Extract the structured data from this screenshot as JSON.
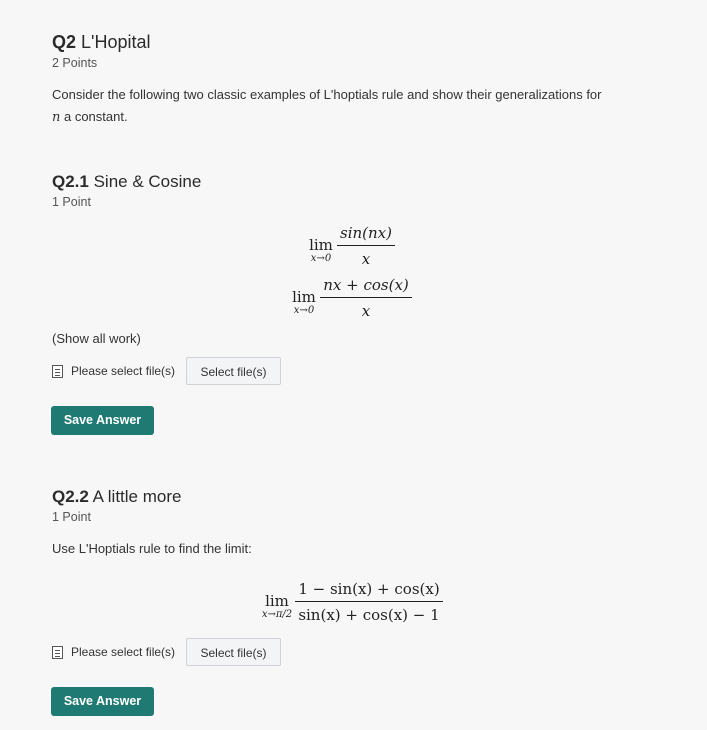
{
  "q2": {
    "number": "Q2",
    "title": "L'Hopital",
    "points": "2 Points",
    "intro": "Consider the following two classic examples of L'hoptials rule and show their generalizations for",
    "intro_var": "n",
    "intro_tail": " a constant."
  },
  "q21": {
    "number": "Q2.1",
    "title": "Sine & Cosine",
    "points": "1 Point",
    "eq1": {
      "lim": "lim",
      "sub": "x→0",
      "num": "sin(nx)",
      "den": "x"
    },
    "eq2": {
      "lim": "lim",
      "sub": "x→0",
      "num": "nx + cos(x)",
      "den": "x"
    },
    "show_work": "(Show all work)",
    "file_label": "Please select file(s)",
    "select_label": "Select file(s)",
    "save_label": "Save Answer"
  },
  "q22": {
    "number": "Q2.2",
    "title": "A little more",
    "points": "1 Point",
    "prompt": "Use L'Hoptials rule to find the limit:",
    "eq": {
      "lim": "lim",
      "sub": "x→π/2",
      "num": "1 − sin(x) + cos(x)",
      "den": "sin(x) + cos(x) − 1"
    },
    "file_label": "Please select file(s)",
    "select_label": "Select file(s)",
    "save_label": "Save Answer"
  }
}
